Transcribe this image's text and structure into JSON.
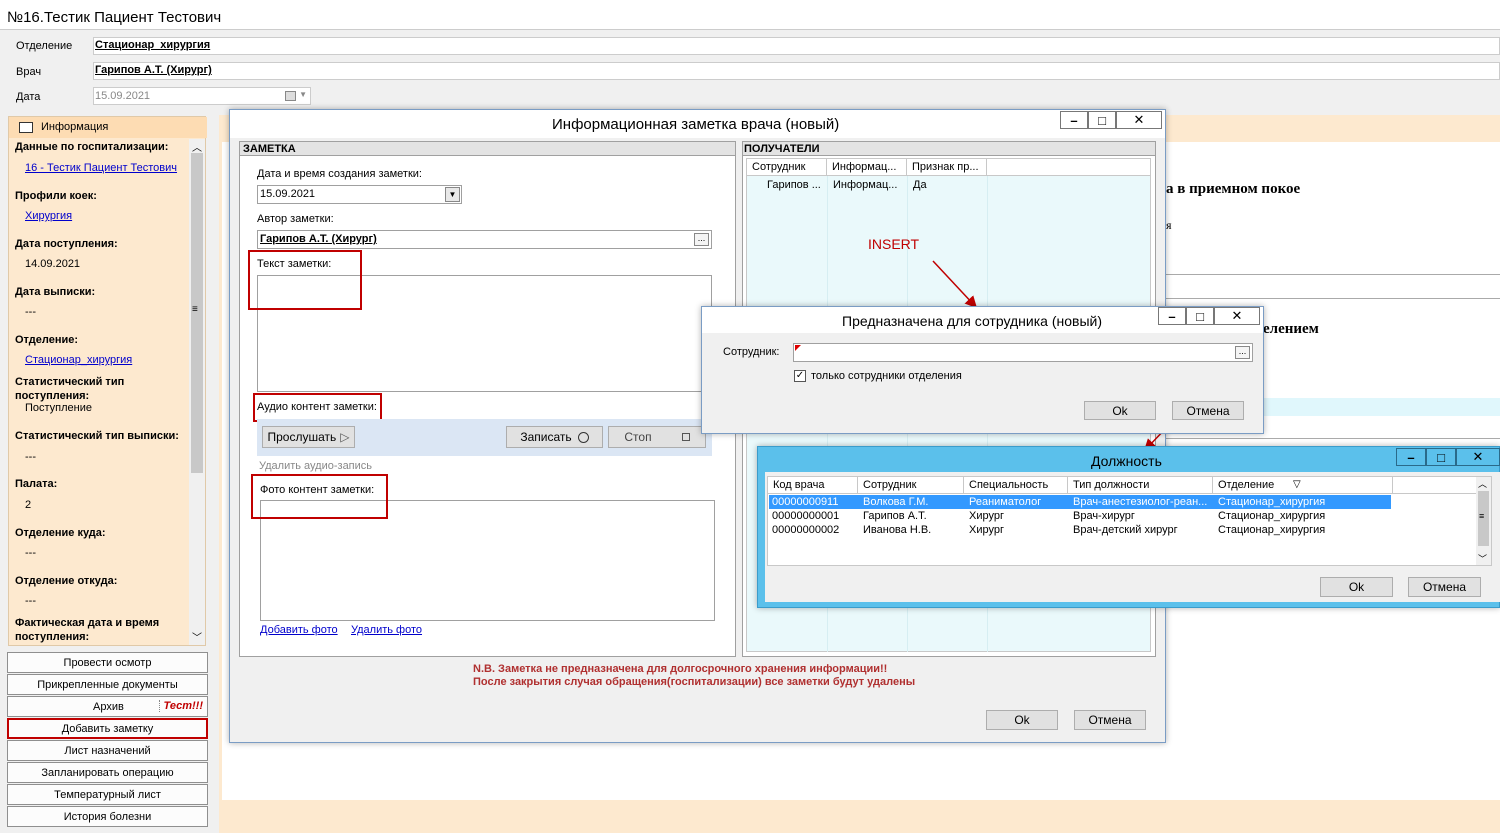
{
  "window": {
    "title": "№16.Тестик Пациент Тестович"
  },
  "header": {
    "department_label": "Отделение",
    "department_value": "Стационар_хирургия",
    "doctor_label": "Врач",
    "doctor_value": "Гарипов А.Т. (Хирург)",
    "date_label": "Дата",
    "date_value": "15.09.2021"
  },
  "sidebar": {
    "info_tab": "Информация",
    "hosp_data_label": "Данные по госпитализации:",
    "hosp_data_value": "16 - Тестик Пациент Тестович",
    "bed_profile_label": "Профили коек:",
    "bed_profile_value": "Хирургия",
    "admission_date_label": "Дата поступления:",
    "admission_date_value": "14.09.2021",
    "discharge_date_label": "Дата выписки:",
    "discharge_date_value": "---",
    "dept_label": "Отделение:",
    "dept_value": "Стационар_хирургия",
    "stat_admission_label": "Статистический тип поступления:",
    "stat_admission_value": "Поступление",
    "stat_discharge_label": "Статистический тип выписки:",
    "stat_discharge_value": "---",
    "ward_label": "Палата:",
    "ward_value": "2",
    "dept_to_label": "Отделение куда:",
    "dept_to_value": "---",
    "dept_from_label": "Отделение откуда:",
    "dept_from_value": "---",
    "actual_admission_label": "Фактическая дата и время поступления:",
    "buttons": [
      "Провести осмотр",
      "Прикрепленные документы",
      "Архив",
      "Добавить заметку",
      "Лист назначений",
      "Запланировать операцию",
      "Температурный лист",
      "История болезни"
    ],
    "archive_tag": "Тест!!!"
  },
  "background": {
    "text1": "а в приемном покое",
    "text2": "я",
    "text3": "елением"
  },
  "note_dialog": {
    "title": "Информационная заметка врача (новый)",
    "note_section": "ЗАМЕТКА",
    "created_label": "Дата и время создания заметки:",
    "created_value": "15.09.2021",
    "author_label": "Автор заметки:",
    "author_value": "Гарипов А.Т. (Хирург)",
    "text_label": "Текст заметки:",
    "audio_label": "Аудио контент заметки:",
    "listen_button": "Прослушать",
    "record_button": "Записать",
    "stop_button": "Стоп",
    "delete_audio": "Удалить аудио-запись",
    "photo_label": "Фото контент заметки:",
    "add_photo": "Добавить фото",
    "delete_photo": "Удалить фото",
    "recipients_section": "ПОЛУЧАТЕЛИ",
    "recipients_columns": [
      "Сотрудник",
      "Информац...",
      "Признак пр..."
    ],
    "recipients_rows": [
      [
        "Гарипов ...",
        "Информац...",
        "Да"
      ]
    ],
    "insert_annotation": "INSERT",
    "warning_line1": "N.B. Заметка не предназначена для долгосрочного хранения информации!!",
    "warning_line2": "После закрытия случая обращения(госпитализации) все заметки будут удалены",
    "ok": "Ok",
    "cancel": "Отмена"
  },
  "employee_dialog": {
    "title": "Предназначена для сотрудника (новый)",
    "employee_label": "Сотрудник:",
    "checkbox_label": "только сотрудники отделения",
    "ok": "Ok",
    "cancel": "Отмена"
  },
  "position_dialog": {
    "title": "Должность",
    "columns": [
      "Код врача",
      "Сотрудник",
      "Специальность",
      "Тип должности",
      "Отделение"
    ],
    "rows": [
      [
        "00000000911",
        "Волкова Г.М.",
        "Реаниматолог",
        "Врач-анестезиолог-реан...",
        "Стационар_хирургия"
      ],
      [
        "00000000001",
        "Гарипов А.Т.",
        "Хирург",
        "Врач-хирург",
        "Стационар_хирургия"
      ],
      [
        "00000000002",
        "Иванова Н.В.",
        "Хирург",
        "Врач-детский хирург",
        "Стационар_хирургия"
      ]
    ],
    "ok": "Ok",
    "cancel": "Отмена"
  },
  "colors": {
    "sidebar_bg": "#fde9cf",
    "title_bar": "#ffffff",
    "selected_row": "#3399ff",
    "highlight": "#c00000",
    "position_title_bar": "#5bc0eb"
  }
}
